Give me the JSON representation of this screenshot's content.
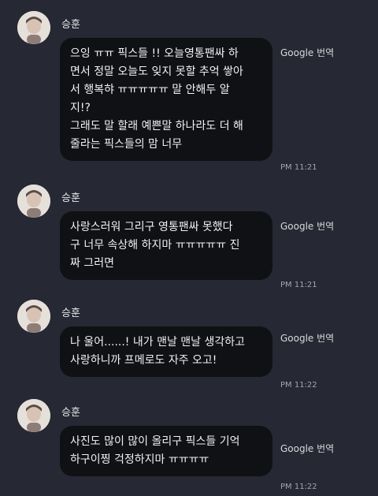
{
  "messages": [
    {
      "sender": "승훈",
      "text": "으잉 ㅠㅠ 픽스들 !! 오늘영통팬싸 하\n면서 정말 오늘도 잊지 못할 추억 쌓아\n서 행복햐 ㅠㅠㅠㅠㅠ 말 안해두 알\n지!?\n그래도 말 할래 예쁜말 하나라도 더 해\n줄라는 픽스들의 맘 너무",
      "translate_label": "Google 번역",
      "time": "PM 11:21"
    },
    {
      "sender": "승훈",
      "text": "사랑스러워 그리구 영통팬싸 못했다\n구 너무 속상해 하지마 ㅠㅠㅠㅠㅠ 진\n짜 그러면",
      "translate_label": "Google 번역",
      "time": "PM 11:21"
    },
    {
      "sender": "승훈",
      "text": "나 울어......! 내가 맨날 맨날 생각하고\n사랑하니까 프메로도 자주 오고!",
      "translate_label": "Google 번역",
      "time": "PM 11:22"
    },
    {
      "sender": "승훈",
      "text": "사진도 많이 많이 올리구 픽스들 기억\n하구이찡 걱정하지마 ㅠㅠㅠㅠ",
      "translate_label": "Google 번역",
      "time": "PM 11:22"
    }
  ],
  "colors": {
    "background": "#262833",
    "bubble": "#101114",
    "text": "#f1f1f3",
    "meta": "#a3a5ad"
  }
}
